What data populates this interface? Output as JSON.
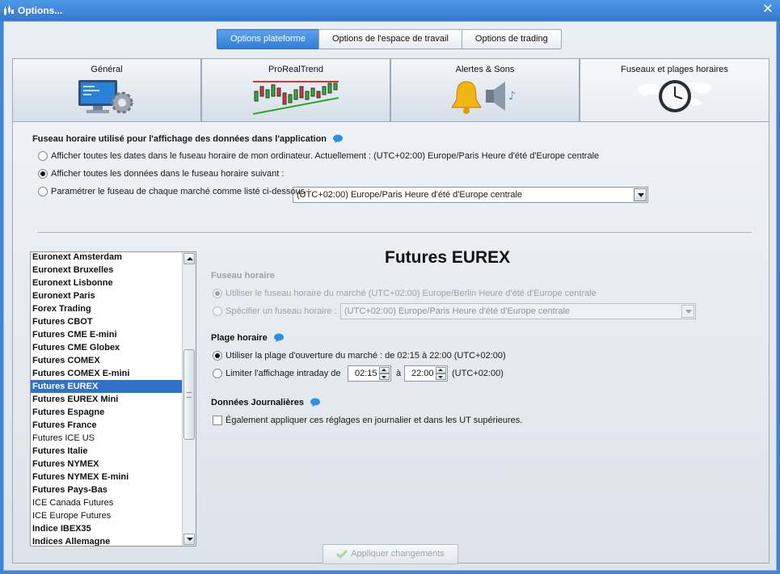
{
  "window": {
    "title": "Options..."
  },
  "top_tabs": [
    {
      "label": "Options plateforme",
      "active": true
    },
    {
      "label": "Options de l'espace de travail",
      "active": false
    },
    {
      "label": "Options de trading",
      "active": false
    }
  ],
  "big_tabs": [
    {
      "label": "Général",
      "icon": "monitor-gear-icon"
    },
    {
      "label": "ProRealTrend",
      "icon": "candlestick-trend-icon"
    },
    {
      "label": "Alertes & Sons",
      "icon": "bell-speaker-icon"
    },
    {
      "label": "Fuseaux et plages horaires",
      "icon": "world-clock-icon",
      "active": true
    }
  ],
  "timezone": {
    "heading": "Fuseau horaire utilisé pour l'affichage des données dans l'application",
    "opt1": "Afficher toutes les dates dans le fuseau horaire de mon ordinateur. Actuellement : (UTC+02:00) Europe/Paris Heure d'été d'Europe centrale",
    "opt2": "Afficher toutes les données dans le fuseau horaire suivant :",
    "opt2_value": "(UTC+02:00) Europe/Paris Heure d'été d'Europe centrale",
    "opt3": "Paramétrer le fuseau de chaque marché comme listé ci-dessous :",
    "selected": 2
  },
  "markets": [
    {
      "label": "Euronext Amsterdam",
      "bold": true
    },
    {
      "label": "Euronext Bruxelles",
      "bold": true
    },
    {
      "label": "Euronext Lisbonne",
      "bold": true
    },
    {
      "label": "Euronext Paris",
      "bold": true
    },
    {
      "label": "Forex Trading",
      "bold": true
    },
    {
      "label": "Futures CBOT",
      "bold": true
    },
    {
      "label": "Futures CME E-mini",
      "bold": true
    },
    {
      "label": "Futures CME Globex",
      "bold": true
    },
    {
      "label": "Futures COMEX",
      "bold": true
    },
    {
      "label": "Futures COMEX E-mini",
      "bold": true
    },
    {
      "label": "Futures EUREX",
      "bold": true,
      "selected": true
    },
    {
      "label": "Futures EUREX Mini",
      "bold": true
    },
    {
      "label": "Futures Espagne",
      "bold": true
    },
    {
      "label": "Futures France",
      "bold": true
    },
    {
      "label": "Futures ICE US",
      "bold": false
    },
    {
      "label": "Futures Italie",
      "bold": true
    },
    {
      "label": "Futures NYMEX",
      "bold": true
    },
    {
      "label": "Futures NYMEX E-mini",
      "bold": true
    },
    {
      "label": "Futures Pays-Bas",
      "bold": true
    },
    {
      "label": "ICE Canada Futures",
      "bold": false
    },
    {
      "label": "ICE Europe Futures",
      "bold": false
    },
    {
      "label": "Indice IBEX35",
      "bold": true
    },
    {
      "label": "Indices Allemagne",
      "bold": true
    }
  ],
  "detail": {
    "title": "Futures EUREX",
    "fuseau_heading": "Fuseau horaire",
    "fuseau_opt1": "Utiliser le fuseau horaire du marché (UTC+02:00) Europe/Berlin Heure d'été d'Europe centrale",
    "fuseau_opt2": "Spécifier un fuseau horaire :",
    "fuseau_opt2_value": "(UTC+02:00) Europe/Paris Heure d'été d'Europe centrale",
    "plage_heading": "Plage horaire",
    "plage_opt1": "Utiliser la plage d'ouverture du marché : de 02:15 à 22:00  (UTC+02:00)",
    "plage_opt2": "Limiter l'affichage intraday  de",
    "plage_from": "02:15",
    "plage_to_label": "à",
    "plage_to": "22:00",
    "plage_tz": "(UTC+02:00)",
    "daily_heading": "Données Journalières",
    "daily_check": "Également appliquer ces réglages en journalier et dans les UT supérieures."
  },
  "apply_label": "Appliquer changements",
  "colors": {
    "accent": "#2f7fd6",
    "selection": "#3072c9",
    "titlebar": "#3f86d9"
  }
}
